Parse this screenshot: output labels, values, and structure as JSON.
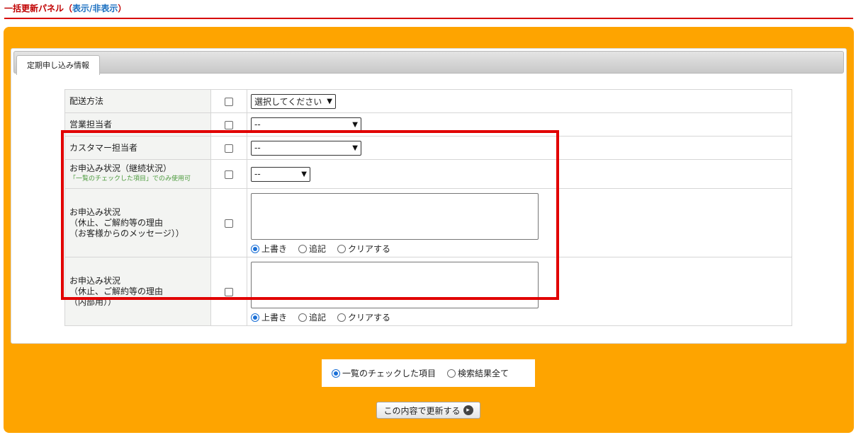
{
  "header": {
    "title": "一括更新パネル",
    "paren_open": "（",
    "toggle_link": "表示/非表示",
    "paren_close": "）"
  },
  "tabs": [
    {
      "label": "定期申し込み情報",
      "active": true
    }
  ],
  "rows": [
    {
      "label": "配送方法",
      "select": "選択してください"
    },
    {
      "label": "営業担当者",
      "select": "--"
    },
    {
      "label": "カスタマー担当者",
      "select": "--"
    },
    {
      "label": "お申込み状況（継続状況）",
      "note": "「一覧のチェックした項目」でのみ使用可",
      "select": "--"
    },
    {
      "label_lines": [
        "お申込み状況",
        "（休止、ご解約等の理由",
        "（お客様からのメッセージ））"
      ],
      "textarea": "",
      "radios": [
        "上書き",
        "追記",
        "クリアする"
      ],
      "radio_selected": 0
    },
    {
      "label_lines": [
        "お申込み状況",
        "（休止、ご解約等の理由",
        "（内部用））"
      ],
      "textarea": "",
      "radios": [
        "上書き",
        "追記",
        "クリアする"
      ],
      "radio_selected": 0
    }
  ],
  "target": {
    "options": [
      "一覧のチェックした項目",
      "検索結果全て"
    ],
    "selected": 0
  },
  "update_button": {
    "label": "この内容で更新する"
  },
  "colors": {
    "panel": "#fea400",
    "header_line": "#d60000",
    "highlight": "#e10000",
    "note": "#4b9a3c",
    "link": "#1a6fc0"
  }
}
